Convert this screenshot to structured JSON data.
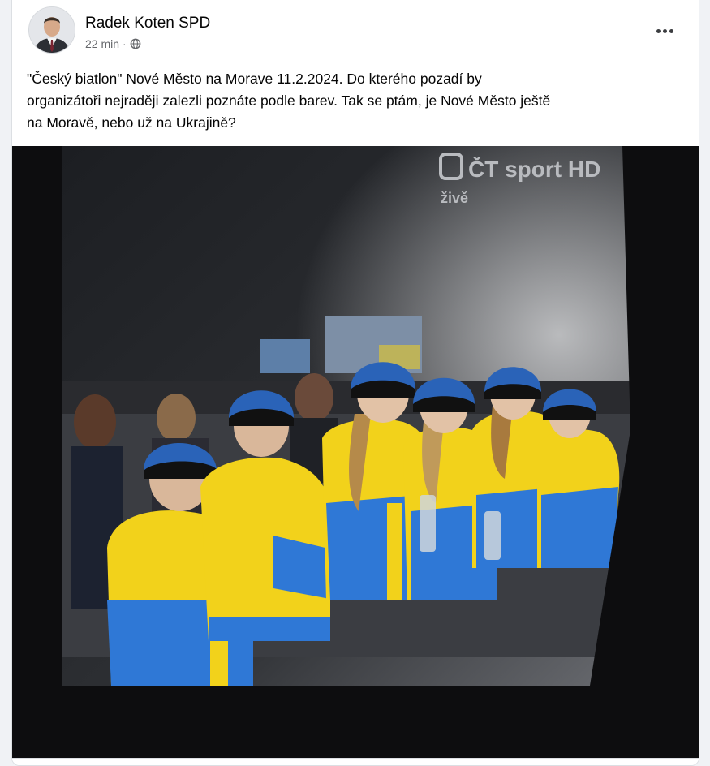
{
  "post": {
    "author": "Radek Koten SPD",
    "time": "22 min",
    "dot": "·",
    "privacy_icon": "globe-icon",
    "more_icon": "more-icon",
    "text_lines": [
      "\"Český biatlon\" Nové Město na Morave 11.2.2024. Do kterého pozadí by",
      "organizátoři nejraději zalezli poznáte podle barev. Tak se ptám, je Nové Město ještě",
      "na Moravě, nebo už na Ukrajině?"
    ]
  },
  "photo": {
    "watermark_logo": "ČT sport HD",
    "watermark_live": "živě",
    "colors": {
      "jacket_yellow": "#f2d21b",
      "jacket_blue": "#2f78d6",
      "hat_blue": "#2a63b8",
      "sky": "#2a2c30"
    }
  }
}
